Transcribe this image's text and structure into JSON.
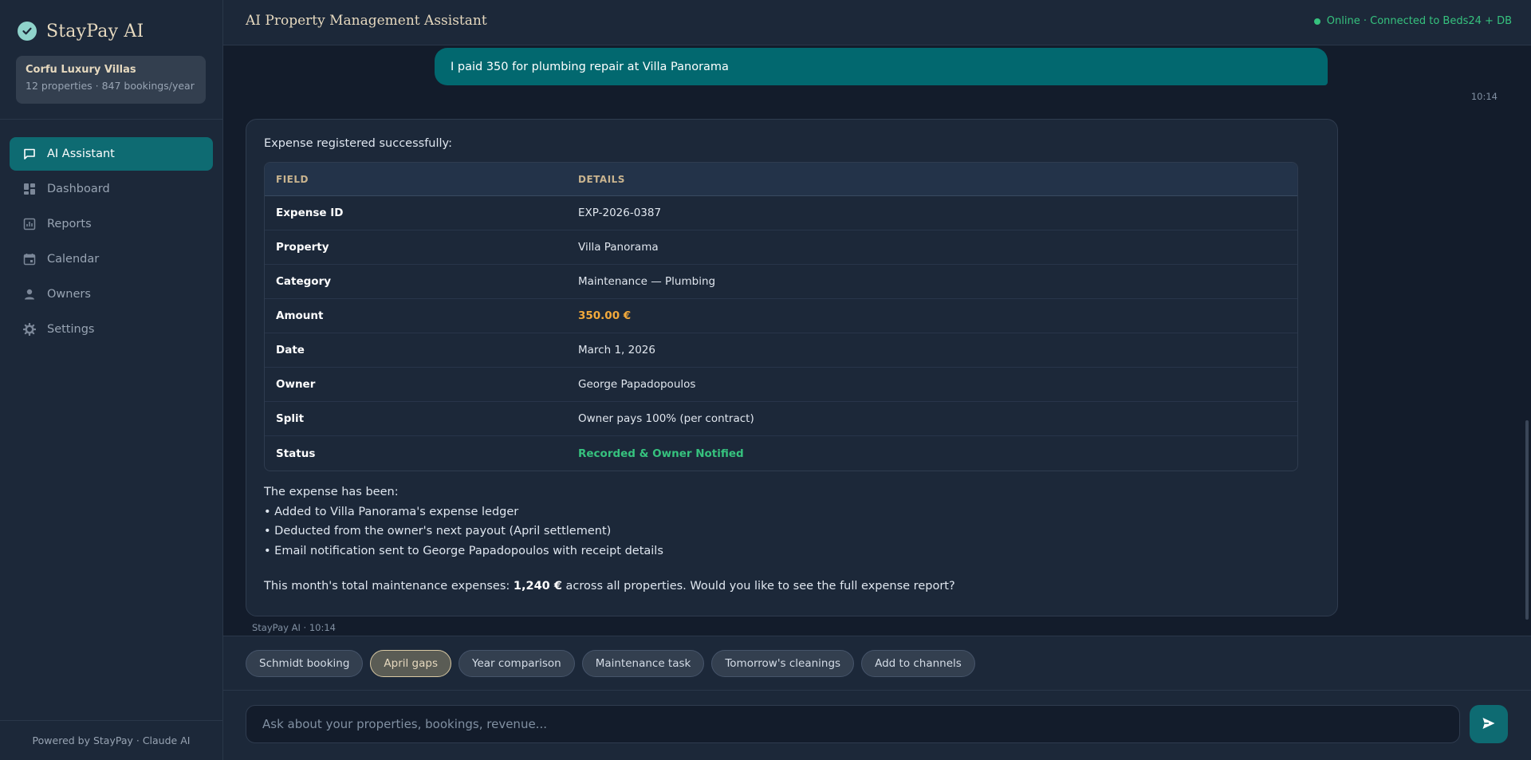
{
  "brand": {
    "name": "StayPay AI"
  },
  "org": {
    "name": "Corfu Luxury Villas",
    "meta": "12 properties · 847 bookings/year"
  },
  "nav": [
    {
      "label": "AI Assistant",
      "icon": "chat-icon",
      "active": true
    },
    {
      "label": "Dashboard",
      "icon": "dashboard-icon"
    },
    {
      "label": "Reports",
      "icon": "reports-icon"
    },
    {
      "label": "Calendar",
      "icon": "calendar-icon"
    },
    {
      "label": "Owners",
      "icon": "person-icon"
    },
    {
      "label": "Settings",
      "icon": "gear-icon"
    }
  ],
  "footer": "Powered by StayPay · Claude AI",
  "header": {
    "title": "AI Property Management Assistant",
    "status": "Online · Connected to Beds24 + DB"
  },
  "chat": {
    "user_message": "I paid 350 for plumbing repair at Villa Panorama",
    "user_time": "10:14",
    "ai_intro": "Expense registered successfully:",
    "table": {
      "headers": [
        "FIELD",
        "DETAILS"
      ],
      "rows": [
        {
          "field": "Expense ID",
          "details": "EXP-2026-0387"
        },
        {
          "field": "Property",
          "details": "Villa Panorama"
        },
        {
          "field": "Category",
          "details": "Maintenance — Plumbing"
        },
        {
          "field": "Amount",
          "details": "350.00 €"
        },
        {
          "field": "Date",
          "details": "March 1, 2026"
        },
        {
          "field": "Owner",
          "details": "George Papadopoulos"
        },
        {
          "field": "Split",
          "details": "Owner pays 100% (per contract)"
        },
        {
          "field": "Status",
          "details": "Recorded & Owner Notified"
        }
      ]
    },
    "body_lines": [
      "The expense has been:",
      "• Added to Villa Panorama's expense ledger",
      "• Deducted from the owner's next payout (April settlement)",
      "• Email notification sent to George Papadopoulos with receipt details"
    ],
    "summary_prefix": "This month's total maintenance expenses: ",
    "summary_amount": "1,240 €",
    "summary_suffix": " across all properties. Would you like to see the full expense report?",
    "ai_meta": "StayPay AI · 10:14"
  },
  "suggestions": [
    {
      "label": "Schmidt booking"
    },
    {
      "label": "April gaps",
      "active": true
    },
    {
      "label": "Year comparison"
    },
    {
      "label": "Maintenance task"
    },
    {
      "label": "Tomorrow's cleanings"
    },
    {
      "label": "Add to channels"
    }
  ],
  "composer": {
    "placeholder": "Ask about your properties, bookings, revenue...",
    "value": ""
  },
  "colors": {
    "accent": "#0e6b72",
    "amount": "#f2a93b",
    "success": "#36c27e",
    "gold": "#e6d9bf"
  }
}
